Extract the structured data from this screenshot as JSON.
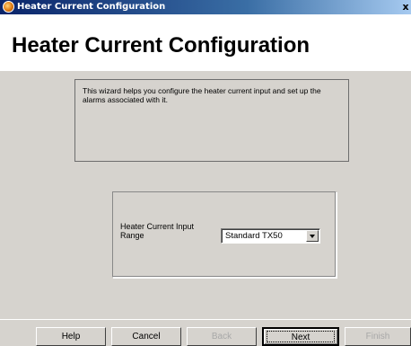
{
  "window": {
    "title": "Heater Current Configuration",
    "close_glyph": "x"
  },
  "header": {
    "title": "Heater Current Configuration"
  },
  "description": {
    "text": "This wizard helps you configure the heater current input and set up the alarms associated with it."
  },
  "range": {
    "label": "Heater Current Input Range",
    "selected": "Standard TX50"
  },
  "buttons": {
    "help": "Help",
    "cancel": "Cancel",
    "back": "Back",
    "next": "Next",
    "finish": "Finish"
  },
  "icons": {
    "app": "wizard-app-icon",
    "dropdown": "chevron-down-icon"
  }
}
